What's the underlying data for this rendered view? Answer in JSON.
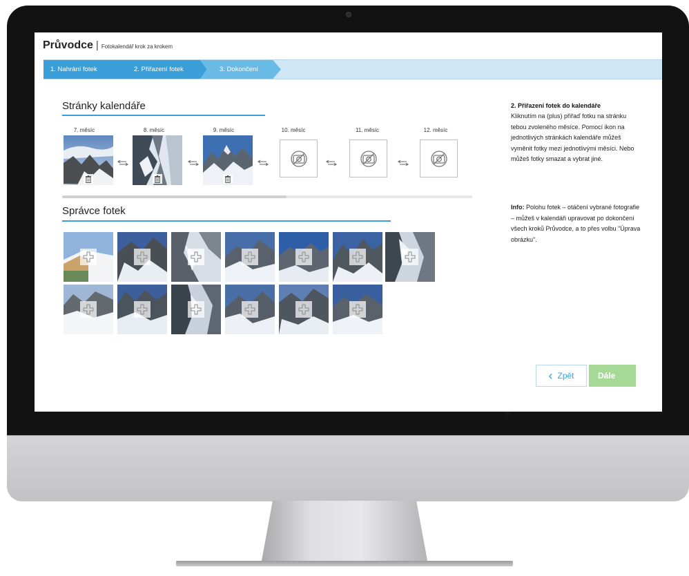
{
  "header": {
    "app_name": "Průvodce",
    "separator": "|",
    "subtitle": "Fotokalendář krok za krokem"
  },
  "steps": [
    {
      "label": "1. Nahrání fotek",
      "state": "done"
    },
    {
      "label": "2. Přiřazení fotek",
      "state": "active"
    },
    {
      "label": "3. Dokončení",
      "state": "pending"
    }
  ],
  "calendar": {
    "title": "Stránky kalendáře",
    "months": [
      {
        "label": "7. měsíc",
        "filled": true,
        "icon": "trash-icon"
      },
      {
        "label": "8. měsíc",
        "filled": true,
        "icon": "trash-icon"
      },
      {
        "label": "9. měsíc",
        "filled": true,
        "icon": "trash-icon"
      },
      {
        "label": "10. měsíc",
        "filled": false,
        "icon": "camera-off-icon"
      },
      {
        "label": "11. měsíc",
        "filled": false,
        "icon": "camera-off-icon"
      },
      {
        "label": "12. měsíc",
        "filled": false,
        "icon": "camera-off-icon"
      }
    ],
    "swap_icon": "swap-arrows-icon"
  },
  "photo_manager": {
    "title": "Správce fotek",
    "photo_count": 13,
    "add_icon": "plus-icon"
  },
  "help": {
    "title": "2. Přiřazení fotek do kalendáře",
    "text": "Kliknutím na (plus) přiřaď fotku na stránku tebou zvoleného měsíce. Pomocí ikon na jednotlivých stránkách kalendáře můžeš vyměnit fotky mezi jednotlivými měsíci. Nebo můžeš fotky smazat a vybrat jiné.",
    "info_label": "Info:",
    "info_text": "Polohu fotek – otáčení vybrané fotografie – můžeš v kalendáři upravovat po dokončení všech kroků Průvodce, a to přes volbu \"Úprava obrázku\"."
  },
  "buttons": {
    "back_label": "Zpět",
    "next_label": "Dále"
  },
  "colors": {
    "accent": "#3a9fd9",
    "step_pending": "#69bbe6",
    "next_disabled": "#a6d996",
    "monitor_bezel": "#121212"
  }
}
